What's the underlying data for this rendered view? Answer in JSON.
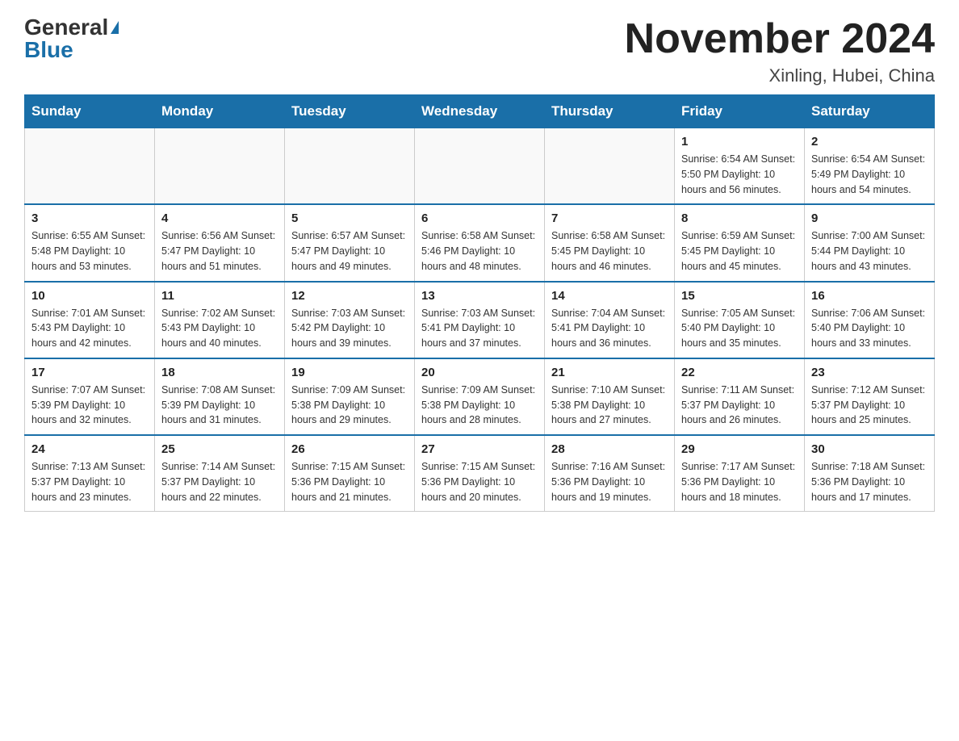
{
  "header": {
    "logo_general": "General",
    "logo_blue": "Blue",
    "month_title": "November 2024",
    "location": "Xinling, Hubei, China"
  },
  "days_of_week": [
    "Sunday",
    "Monday",
    "Tuesday",
    "Wednesday",
    "Thursday",
    "Friday",
    "Saturday"
  ],
  "weeks": [
    [
      {
        "day": "",
        "info": ""
      },
      {
        "day": "",
        "info": ""
      },
      {
        "day": "",
        "info": ""
      },
      {
        "day": "",
        "info": ""
      },
      {
        "day": "",
        "info": ""
      },
      {
        "day": "1",
        "info": "Sunrise: 6:54 AM\nSunset: 5:50 PM\nDaylight: 10 hours and 56 minutes."
      },
      {
        "day": "2",
        "info": "Sunrise: 6:54 AM\nSunset: 5:49 PM\nDaylight: 10 hours and 54 minutes."
      }
    ],
    [
      {
        "day": "3",
        "info": "Sunrise: 6:55 AM\nSunset: 5:48 PM\nDaylight: 10 hours and 53 minutes."
      },
      {
        "day": "4",
        "info": "Sunrise: 6:56 AM\nSunset: 5:47 PM\nDaylight: 10 hours and 51 minutes."
      },
      {
        "day": "5",
        "info": "Sunrise: 6:57 AM\nSunset: 5:47 PM\nDaylight: 10 hours and 49 minutes."
      },
      {
        "day": "6",
        "info": "Sunrise: 6:58 AM\nSunset: 5:46 PM\nDaylight: 10 hours and 48 minutes."
      },
      {
        "day": "7",
        "info": "Sunrise: 6:58 AM\nSunset: 5:45 PM\nDaylight: 10 hours and 46 minutes."
      },
      {
        "day": "8",
        "info": "Sunrise: 6:59 AM\nSunset: 5:45 PM\nDaylight: 10 hours and 45 minutes."
      },
      {
        "day": "9",
        "info": "Sunrise: 7:00 AM\nSunset: 5:44 PM\nDaylight: 10 hours and 43 minutes."
      }
    ],
    [
      {
        "day": "10",
        "info": "Sunrise: 7:01 AM\nSunset: 5:43 PM\nDaylight: 10 hours and 42 minutes."
      },
      {
        "day": "11",
        "info": "Sunrise: 7:02 AM\nSunset: 5:43 PM\nDaylight: 10 hours and 40 minutes."
      },
      {
        "day": "12",
        "info": "Sunrise: 7:03 AM\nSunset: 5:42 PM\nDaylight: 10 hours and 39 minutes."
      },
      {
        "day": "13",
        "info": "Sunrise: 7:03 AM\nSunset: 5:41 PM\nDaylight: 10 hours and 37 minutes."
      },
      {
        "day": "14",
        "info": "Sunrise: 7:04 AM\nSunset: 5:41 PM\nDaylight: 10 hours and 36 minutes."
      },
      {
        "day": "15",
        "info": "Sunrise: 7:05 AM\nSunset: 5:40 PM\nDaylight: 10 hours and 35 minutes."
      },
      {
        "day": "16",
        "info": "Sunrise: 7:06 AM\nSunset: 5:40 PM\nDaylight: 10 hours and 33 minutes."
      }
    ],
    [
      {
        "day": "17",
        "info": "Sunrise: 7:07 AM\nSunset: 5:39 PM\nDaylight: 10 hours and 32 minutes."
      },
      {
        "day": "18",
        "info": "Sunrise: 7:08 AM\nSunset: 5:39 PM\nDaylight: 10 hours and 31 minutes."
      },
      {
        "day": "19",
        "info": "Sunrise: 7:09 AM\nSunset: 5:38 PM\nDaylight: 10 hours and 29 minutes."
      },
      {
        "day": "20",
        "info": "Sunrise: 7:09 AM\nSunset: 5:38 PM\nDaylight: 10 hours and 28 minutes."
      },
      {
        "day": "21",
        "info": "Sunrise: 7:10 AM\nSunset: 5:38 PM\nDaylight: 10 hours and 27 minutes."
      },
      {
        "day": "22",
        "info": "Sunrise: 7:11 AM\nSunset: 5:37 PM\nDaylight: 10 hours and 26 minutes."
      },
      {
        "day": "23",
        "info": "Sunrise: 7:12 AM\nSunset: 5:37 PM\nDaylight: 10 hours and 25 minutes."
      }
    ],
    [
      {
        "day": "24",
        "info": "Sunrise: 7:13 AM\nSunset: 5:37 PM\nDaylight: 10 hours and 23 minutes."
      },
      {
        "day": "25",
        "info": "Sunrise: 7:14 AM\nSunset: 5:37 PM\nDaylight: 10 hours and 22 minutes."
      },
      {
        "day": "26",
        "info": "Sunrise: 7:15 AM\nSunset: 5:36 PM\nDaylight: 10 hours and 21 minutes."
      },
      {
        "day": "27",
        "info": "Sunrise: 7:15 AM\nSunset: 5:36 PM\nDaylight: 10 hours and 20 minutes."
      },
      {
        "day": "28",
        "info": "Sunrise: 7:16 AM\nSunset: 5:36 PM\nDaylight: 10 hours and 19 minutes."
      },
      {
        "day": "29",
        "info": "Sunrise: 7:17 AM\nSunset: 5:36 PM\nDaylight: 10 hours and 18 minutes."
      },
      {
        "day": "30",
        "info": "Sunrise: 7:18 AM\nSunset: 5:36 PM\nDaylight: 10 hours and 17 minutes."
      }
    ]
  ]
}
